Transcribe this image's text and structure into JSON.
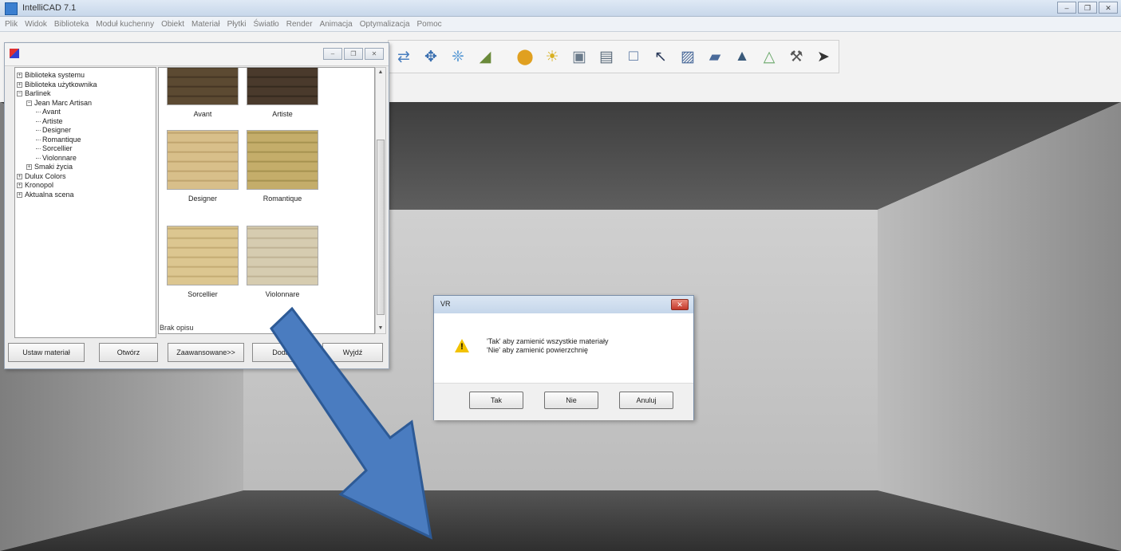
{
  "window": {
    "title": "IntelliCAD 7.1",
    "controls": {
      "minimize": "–",
      "restore": "❐",
      "close": "✕"
    }
  },
  "menu": {
    "items": [
      "Plik",
      "Widok",
      "Biblioteka",
      "Moduł kuchenny",
      "Obiekt",
      "Materiał",
      "Płytki",
      "Światło",
      "Render",
      "Animacja",
      "Optymalizacja",
      "Pomoc"
    ]
  },
  "toolbar": {
    "icons": [
      {
        "name": "refresh-icon",
        "glyph": "⇄",
        "color": "#4a7fbf"
      },
      {
        "name": "move-icon",
        "glyph": "✥",
        "color": "#3a6fb0"
      },
      {
        "name": "orbit-icon",
        "glyph": "❈",
        "color": "#5b9bd5"
      },
      {
        "name": "terrain-icon",
        "glyph": "◢",
        "color": "#6a8a3a"
      },
      {
        "name": "color-palette-icon",
        "glyph": "⬤",
        "color": "#e0a020"
      },
      {
        "name": "light-bulb-icon",
        "glyph": "☀",
        "color": "#d8b020"
      },
      {
        "name": "camera-icon",
        "glyph": "▣",
        "color": "#6a7a8a"
      },
      {
        "name": "render-icon",
        "glyph": "▤",
        "color": "#5a6a7a"
      },
      {
        "name": "document-icon",
        "glyph": "□",
        "color": "#4a6a9a"
      },
      {
        "name": "select-arrow-icon",
        "glyph": "↖",
        "color": "#2a3a5a"
      },
      {
        "name": "select-object-icon",
        "glyph": "▨",
        "color": "#4a6a9a"
      },
      {
        "name": "select-region-icon",
        "glyph": "▰",
        "color": "#4a6a9a"
      },
      {
        "name": "triangle-icon",
        "glyph": "▲",
        "color": "#3a5a7a"
      },
      {
        "name": "pyramid-icon",
        "glyph": "△",
        "color": "#6aa86a"
      },
      {
        "name": "tools-icon",
        "glyph": "⚒",
        "color": "#555555"
      },
      {
        "name": "pointer-icon",
        "glyph": "➤",
        "color": "#333333"
      }
    ]
  },
  "material_panel": {
    "controls": {
      "minimize": "–",
      "restore": "❐",
      "close": "✕"
    },
    "tree": [
      {
        "label": "Biblioteka systemu",
        "level": 0,
        "expander": "+"
      },
      {
        "label": "Biblioteka użytkownika",
        "level": 0,
        "expander": "+"
      },
      {
        "label": "Barlinek",
        "level": 0,
        "expander": "−"
      },
      {
        "label": "Jean Marc Artisan",
        "level": 1,
        "expander": "−"
      },
      {
        "label": "Avant",
        "level": 2,
        "expander": ""
      },
      {
        "label": "Artiste",
        "level": 2,
        "expander": ""
      },
      {
        "label": "Designer",
        "level": 2,
        "expander": ""
      },
      {
        "label": "Romantique",
        "level": 2,
        "expander": ""
      },
      {
        "label": "Sorcellier",
        "level": 2,
        "expander": ""
      },
      {
        "label": "Violonnare",
        "level": 2,
        "expander": ""
      },
      {
        "label": "Smaki życia",
        "level": 1,
        "expander": "+"
      },
      {
        "label": "Dulux Colors",
        "level": 0,
        "expander": "+"
      },
      {
        "label": "Kronopol",
        "level": 0,
        "expander": "+"
      },
      {
        "label": "Aktualna scena",
        "level": 0,
        "expander": "+"
      }
    ],
    "thumbnails": [
      {
        "label": "Avant",
        "color": "#5c4a32",
        "grain": "#3e3020"
      },
      {
        "label": "Artiste",
        "color": "#4a3a2c",
        "grain": "#2e241a"
      },
      {
        "label": "Designer",
        "color": "#d8bf8a",
        "grain": "#b89c64"
      },
      {
        "label": "Romantique",
        "color": "#c4ad6a",
        "grain": "#9c8a48"
      },
      {
        "label": "Sorcellier",
        "color": "#dcc690",
        "grain": "#bca36a"
      },
      {
        "label": "Violonnare",
        "color": "#d6ccb0",
        "grain": "#b8ab8c"
      }
    ],
    "description": "Brak opisu",
    "buttons": {
      "set_material": "Ustaw materiał",
      "open": "Otwórz",
      "advanced": "Zaawansowane>>",
      "hidden": "Dodaj",
      "exit": "Wyjdź"
    }
  },
  "dialog": {
    "title": "VR",
    "close": "✕",
    "message_line1": "'Tak' aby zamienić wszystkie materiały",
    "message_line2": "'Nie' aby zamienić powierzchnię",
    "warning_mark": "!",
    "buttons": {
      "yes": "Tak",
      "no": "Nie",
      "cancel": "Anuluj"
    }
  },
  "colors": {
    "arrow": "#4a7cc0",
    "arrow_outline": "#2d5a96",
    "ceiling": "#4c4c4c",
    "back_wall": "#c4c4c4",
    "left_wall": "#9e9e9e",
    "right_wall": "#a6a6a6",
    "floor": "#3e3e3e"
  }
}
